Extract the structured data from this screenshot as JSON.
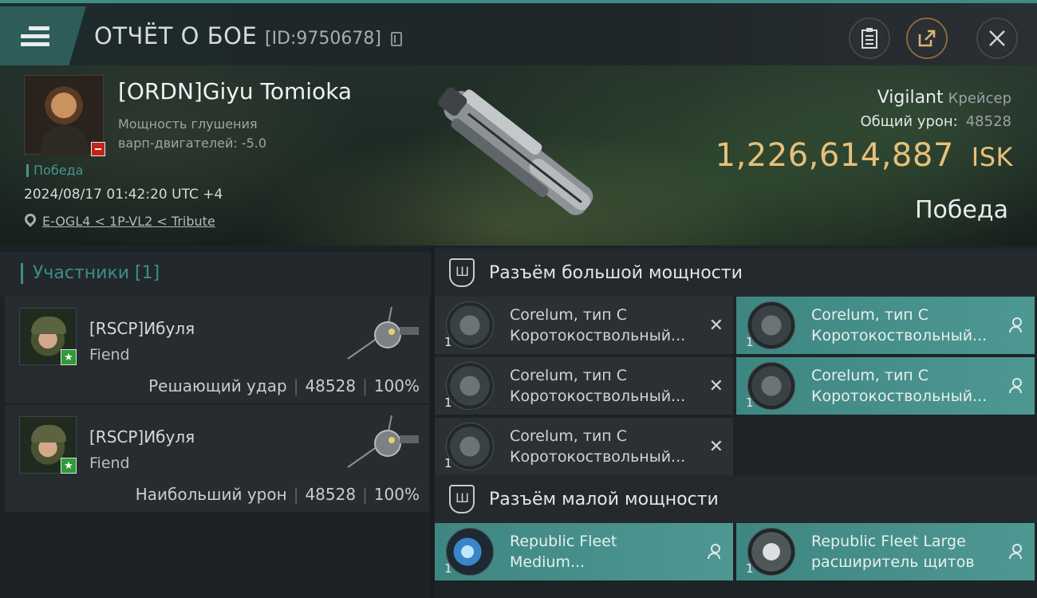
{
  "topbar": {
    "title": "ОТЧЁТ О БОЕ",
    "report_id": "[ID:9750678]",
    "icons": [
      "menu-icon",
      "copy-icon",
      "clipboard-icon",
      "share-icon",
      "close-icon"
    ]
  },
  "victim": {
    "name": "[ORDN]Giyu Tomioka",
    "attr_line1": "Мощность глушения",
    "attr_line2": "варп-двигателей: -5.0",
    "result_tag": "Победа",
    "datetime": "2024/08/17 01:42:20 UTC +4",
    "location": "E-OGL4 < 1P-VL2 < Tribute",
    "ship_name": "Vigilant",
    "ship_class": "Крейсер",
    "total_damage_label": "Общий урон:",
    "total_damage": "48528",
    "isk_value": "1,226,614,887",
    "isk_unit": "ISK",
    "outcome": "Победа"
  },
  "participants": {
    "header": "Участники [1]",
    "rows": [
      {
        "name": "[RSCP]Ибуля",
        "ship": "Fiend",
        "role": "Решающий удар",
        "damage": "48528",
        "percent": "100%"
      },
      {
        "name": "[RSCP]Ибуля",
        "ship": "Fiend",
        "role": "Наибольший урон",
        "damage": "48528",
        "percent": "100%"
      }
    ]
  },
  "fitting": {
    "high_slot_title": "Разъём большой мощности",
    "low_slot_title": "Разъём малой мощности",
    "high_modules": [
      {
        "qty": "1",
        "line1": "Corelum, тип C",
        "line2": "Коротокоствольный...",
        "state": "destroyed"
      },
      {
        "qty": "1",
        "line1": "Corelum, тип C",
        "line2": "Коротокоствольный...",
        "state": "dropped"
      },
      {
        "qty": "1",
        "line1": "Corelum, тип C",
        "line2": "Коротокоствольный...",
        "state": "destroyed"
      },
      {
        "qty": "1",
        "line1": "Corelum, тип C",
        "line2": "Коротокоствольный...",
        "state": "dropped"
      },
      {
        "qty": "1",
        "line1": "Corelum, тип C",
        "line2": "Коротокоствольный...",
        "state": "destroyed"
      }
    ],
    "low_modules": [
      {
        "qty": "1",
        "line1": "Republic Fleet",
        "line2": "Medium...",
        "state": "dropped"
      },
      {
        "qty": "1",
        "line1": "Republic Fleet Large",
        "line2": "расширитель щитов",
        "state": "dropped"
      }
    ]
  },
  "colors": {
    "accent_teal": "#3d8c86",
    "isk_gold": "#e6c07a",
    "kill_badge_red": "#c7211c",
    "star_green": "#2f9a3a"
  }
}
